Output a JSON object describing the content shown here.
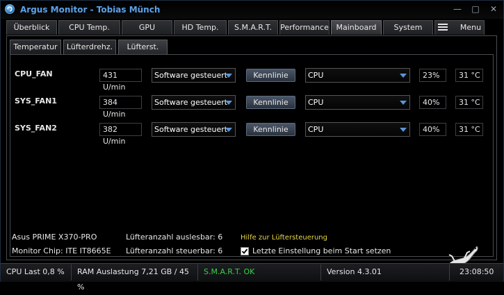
{
  "title": "Argus Monitor - Tobias Münch",
  "window_controls": {
    "minimize": "—",
    "maximize": "□",
    "close": "✕"
  },
  "tabs": [
    "Überblick",
    "CPU Temp.",
    "GPU",
    "HD Temp.",
    "S.M.A.R.T.",
    "Performance",
    "Mainboard",
    "System",
    "Menu"
  ],
  "active_tab": "Mainboard",
  "subtabs": [
    "Temperatur",
    "Lüfterdrehz.",
    "Lüfterst."
  ],
  "active_subtab": "Lüfterst.",
  "fans": [
    {
      "name": "CPU_FAN",
      "rpm": "431 U/min",
      "mode": "Software gesteuert",
      "curve_button": "Kennlinie",
      "source": "CPU",
      "percent": "23%",
      "temp": "31 °C"
    },
    {
      "name": "SYS_FAN1",
      "rpm": "384 U/min",
      "mode": "Software gesteuert",
      "curve_button": "Kennlinie",
      "source": "CPU",
      "percent": "40%",
      "temp": "31 °C"
    },
    {
      "name": "SYS_FAN2",
      "rpm": "382 U/min",
      "mode": "Software gesteuert",
      "curve_button": "Kennlinie",
      "source": "CPU",
      "percent": "40%",
      "temp": "31 °C"
    }
  ],
  "info": {
    "board": "Asus PRIME X370-PRO",
    "chip": "Monitor Chip: ITE IT8665E",
    "readable": "Lüfteranzahl auslesbar: 6",
    "controllable": "Lüfteranzahl steuerbar: 6",
    "help_link": "Hilfe zur Lüftersteuerung",
    "checkbox_label": "Letzte Einstellung beim Start setzen",
    "checkbox_checked": true
  },
  "status": {
    "cpu": "CPU Last 0,8 %",
    "ram": "RAM Auslastung 7,21 GB / 45 %",
    "smart": "S.M.A.R.T. OK",
    "version": "Version 4.3.01",
    "time": "23:08:50"
  },
  "colors": {
    "title": "#5aa2ea",
    "smart_ok": "#34d24a",
    "help_link": "#e5d54a",
    "dropdown_arrow": "#5a96d6"
  }
}
